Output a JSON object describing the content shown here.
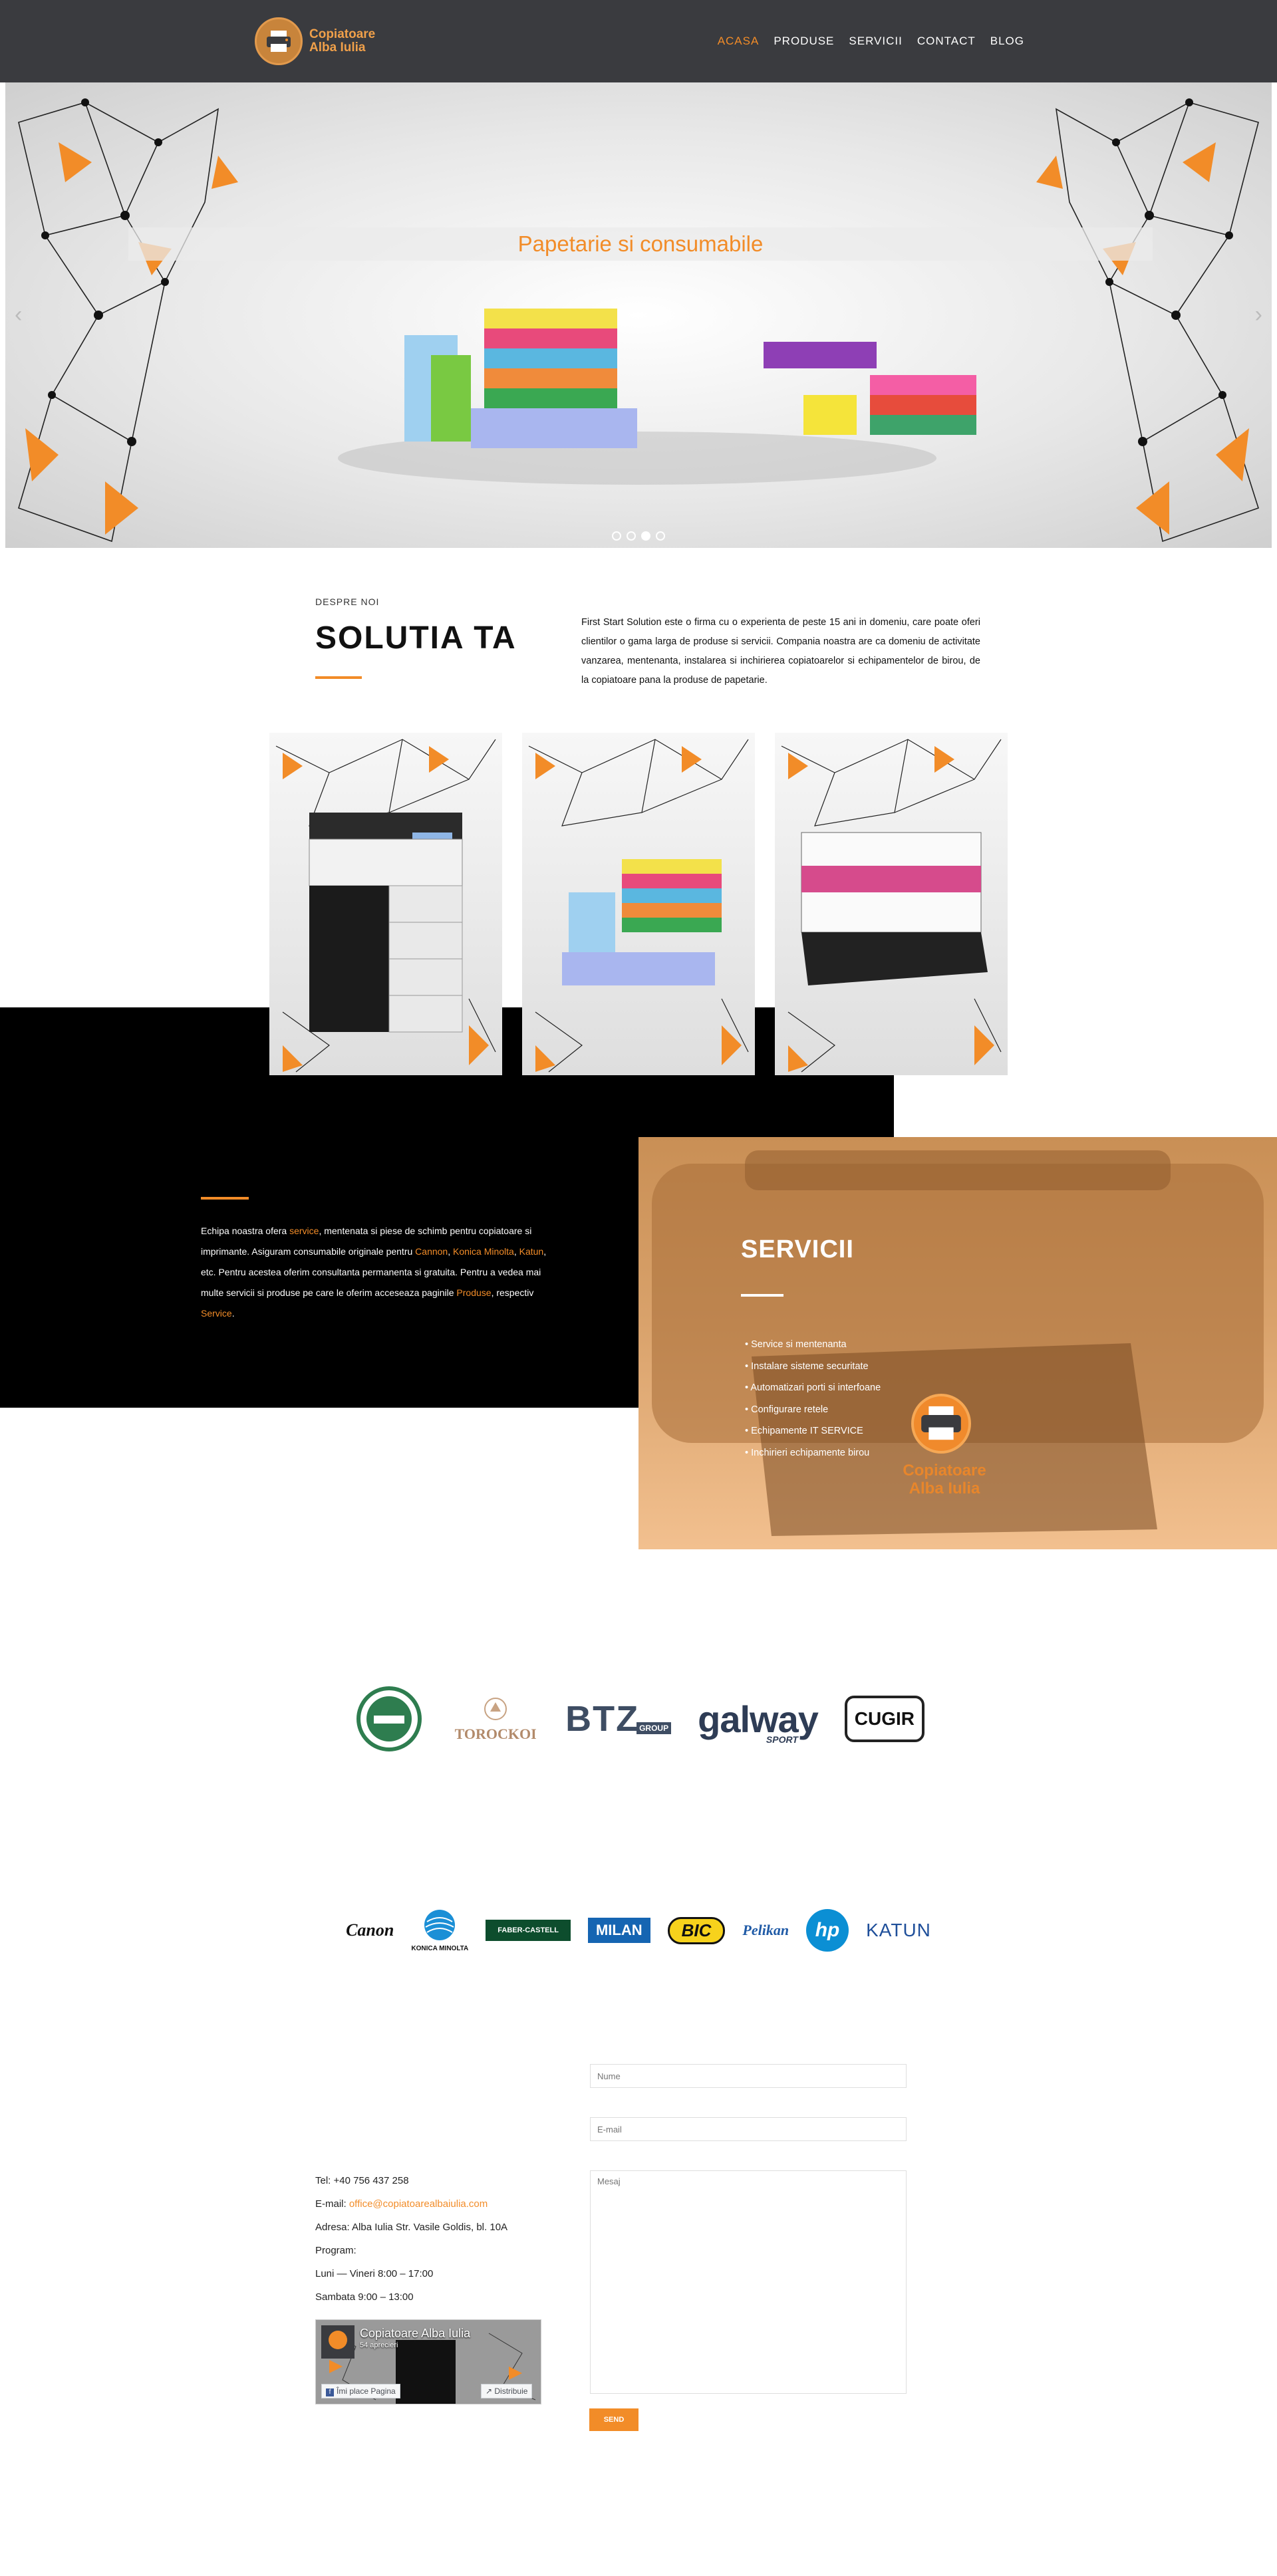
{
  "header": {
    "logo_line1": "Copiatoare",
    "logo_line2": "Alba Iulia",
    "nav": [
      {
        "label": "ACASA",
        "active": true
      },
      {
        "label": "PRODUSE",
        "active": false
      },
      {
        "label": "SERVICII",
        "active": false
      },
      {
        "label": "CONTACT",
        "active": false
      },
      {
        "label": "BLOG",
        "active": false
      }
    ]
  },
  "hero": {
    "caption": "Papetarie si consumabile",
    "prev_icon": "‹",
    "next_icon": "›",
    "slides": 4,
    "active_slide": 3
  },
  "about": {
    "kicker": "DESPRE NOI",
    "title": "SOLUTIA TA",
    "text": "First Start Solution este o firma cu o experienta de peste 15 ani in domeniu, care poate oferi clientilor o gama larga de produse si servicii. Compania noastra are ca domeniu de activitate vanzarea, mentenanta, instalarea si inchirierea copiatoarelor si echipamentelor de birou, de la copiatoare pana la produse de papetarie."
  },
  "cards": [
    {
      "name": "card-copier"
    },
    {
      "name": "card-stationery"
    },
    {
      "name": "card-toner"
    }
  ],
  "band": {
    "p1": "Echipa noastra ofera ",
    "l1": "service",
    "p2": ", mentenata si piese de schimb pentru copiatoare si imprimante. Asiguram consumabile originale pentru ",
    "l2": "Cannon",
    "p3": ", ",
    "l3": "Konica Minolta",
    "p4": ", ",
    "l4": "Katun",
    "p5": ", etc. Pentru acestea oferim consultanta permanenta si gratuita. Pentru a vedea mai multe servicii si produse pe care le oferim acceseaza paginile ",
    "l5": "Produse",
    "p6": ", respectiv ",
    "l6": "Service",
    "p7": "."
  },
  "services": {
    "title": "SERVICII",
    "items": [
      "Service si mentenanta",
      "Instalare sisteme securitate",
      "Automatizari porti si interfoane",
      "Configurare retele",
      "Echipamente IT SERVICE",
      "Inchirieri echipamente birou"
    ],
    "brand_line1": "Copiatoare",
    "brand_line2": "Alba Iulia"
  },
  "clients": {
    "btz": "BTZ",
    "btz_sub": "GROUP",
    "galway": "galway",
    "galway_sub": "SPORT",
    "cugir": "CUGIR",
    "torockoi": "TOROCKOI"
  },
  "brands": {
    "canon": "Canon",
    "konica": "KONICA MINOLTA",
    "faber": "FABER-CASTELL",
    "milan": "MILAN",
    "bic": "BIC",
    "pelikan": "Pelikan",
    "hp": "hp",
    "katun": "KATUN"
  },
  "contact": {
    "tel": "Tel: +40 756 437 258",
    "email_label": "E-mail: ",
    "email": "office@copiatoarealbaiulia.com",
    "address": "Adresa: Alba Iulia Str. Vasile Goldis, bl. 10A",
    "program": "Program:",
    "weekdays": "Luni — Vineri 8:00 – 17:00",
    "saturday": "Sambata 9:00 – 13:00",
    "fb_title": "Copiatoare Alba Iulia",
    "fb_likes": "54 aprecieri",
    "fb_like": "Îmi place Pagina",
    "fb_share": "Distribuie",
    "name_ph": "Nume",
    "email_ph": "E-mail",
    "message_ph": "Mesaj",
    "send": "SEND"
  },
  "colors": {
    "accent": "#f28c28",
    "header_bg": "#3a3b3f",
    "band_bg": "#000000"
  }
}
